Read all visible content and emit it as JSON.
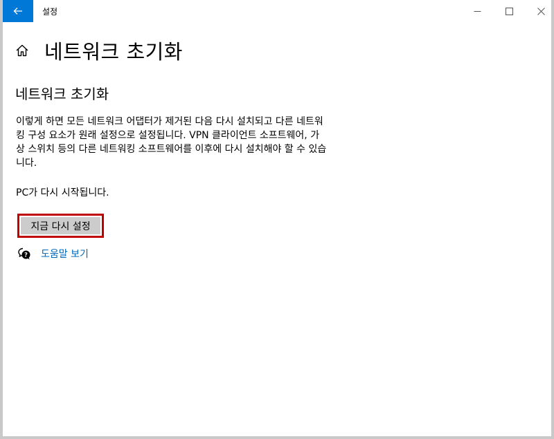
{
  "titlebar": {
    "title": "설정",
    "back_icon": "arrow-left-icon",
    "accent_color": "#0078d7"
  },
  "header": {
    "title": "네트워크 초기화",
    "home_icon": "home-icon"
  },
  "content": {
    "section_title": "네트워크 초기화",
    "description": "이렇게 하면 모든 네트워크 어댑터가 제거된 다음 다시 설치되고 다른 네트워킹 구성 요소가 원래 설정으로 설정됩니다. VPN 클라이언트 소프트웨어, 가상 스위치 등의 다른 네트워킹 소프트웨어를 이후에 다시 설치해야 할 수 있습니다.",
    "restart_note": "PC가 다시 시작됩니다.",
    "reset_button_label": "지금 다시 설정",
    "highlight_color": "#c00000",
    "help_link_label": "도움말 보기",
    "help_icon": "chat-help-icon",
    "link_color": "#0067b8"
  }
}
